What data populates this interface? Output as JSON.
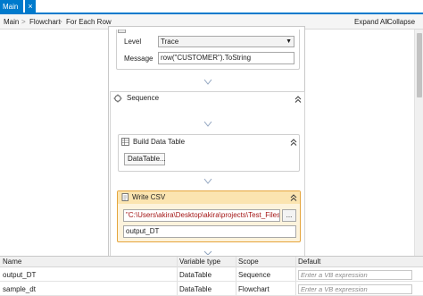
{
  "tab": {
    "label": "Main",
    "close_glyph": "×"
  },
  "breadcrumb": {
    "items": [
      "Main",
      "Flowchart",
      "For Each Row"
    ],
    "separator": ">",
    "expand_all": "Expand All",
    "collapse_all": "Collapse All"
  },
  "log_message": {
    "level_label": "Level",
    "level_value": "Trace",
    "message_label": "Message",
    "message_value": "row(\"CUSTOMER\").ToString"
  },
  "sequence": {
    "title": "Sequence"
  },
  "build_data_table": {
    "title": "Build Data Table",
    "button_label": "DataTable..."
  },
  "write_csv": {
    "title": "Write CSV",
    "path_value": "\"C:\\Users\\akira\\Desktop\\akira\\projects\\Test_Files\\New",
    "browse_label": "...",
    "datatable_value": "output_DT"
  },
  "variables": {
    "headers": [
      "Name",
      "Variable type",
      "Scope",
      "Default"
    ],
    "rows": [
      {
        "name": "output_DT",
        "type": "DataTable",
        "scope": "Sequence",
        "default_placeholder": "Enter a VB expression"
      },
      {
        "name": "sample_dt",
        "type": "DataTable",
        "scope": "Flowchart",
        "default_placeholder": "Enter a VB expression"
      }
    ]
  },
  "colors": {
    "accent": "#007acc",
    "selected_border": "#e5a53c",
    "selected_fill": "#fdf3dc",
    "string_literal": "#a31515"
  }
}
